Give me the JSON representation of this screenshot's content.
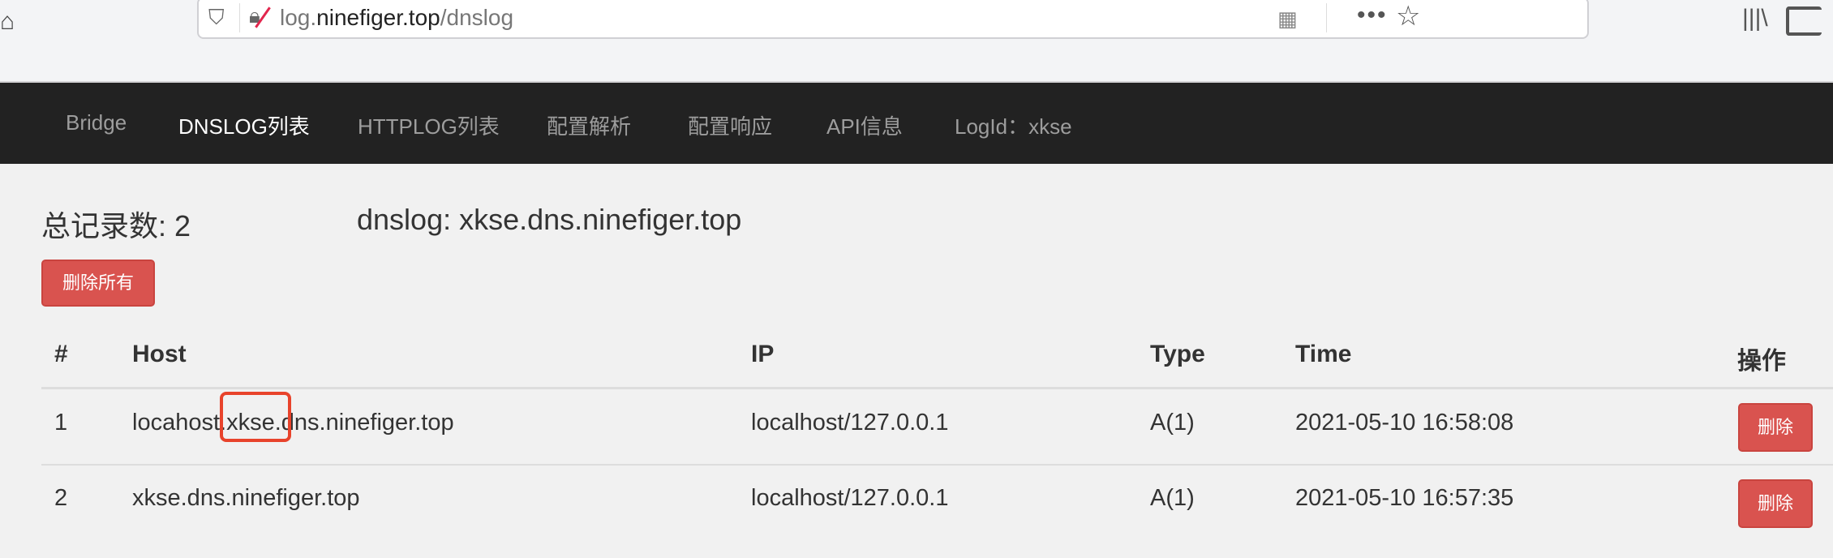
{
  "browser": {
    "url_domain_prefix": "log.",
    "url_domain": "ninefiger.top",
    "url_path": "/dnslog",
    "icons": [
      "home-icon",
      "shield-icon",
      "insecure-lock-icon",
      "qr-code-icon",
      "more-icon",
      "bookmark-star-icon",
      "library-icon",
      "sidebar-icon"
    ]
  },
  "nav": {
    "items": [
      {
        "label": "Bridge",
        "active": false
      },
      {
        "label": "DNSLOG列表",
        "active": true
      },
      {
        "label": "HTTPLOG列表",
        "active": false
      },
      {
        "label": "配置解析",
        "active": false
      },
      {
        "label": "配置响应",
        "active": false
      },
      {
        "label": "API信息",
        "active": false
      },
      {
        "label": "LogId：xkse",
        "active": false
      }
    ]
  },
  "summary": {
    "total_label": "总记录数: 2",
    "dnslog_label": "dnslog: xkse.dns.ninefiger.top"
  },
  "delete_all_label": "删除所有",
  "table": {
    "headers": [
      "#",
      "Host",
      "IP",
      "Type",
      "Time",
      "操作"
    ],
    "rows": [
      {
        "num": "1",
        "host": "locahost.xkse.dns.ninefiger.top",
        "ip": "localhost/127.0.0.1",
        "type": "A(1)",
        "time": "2021-05-10 16:58:08",
        "action": "删除"
      },
      {
        "num": "2",
        "host": "xkse.dns.ninefiger.top",
        "ip": "localhost/127.0.0.1",
        "type": "A(1)",
        "time": "2021-05-10 16:57:35",
        "action": "删除"
      }
    ]
  },
  "colors": {
    "navbar": "#222222",
    "danger": "#d9534f",
    "highlight_box": "#e8432b"
  }
}
